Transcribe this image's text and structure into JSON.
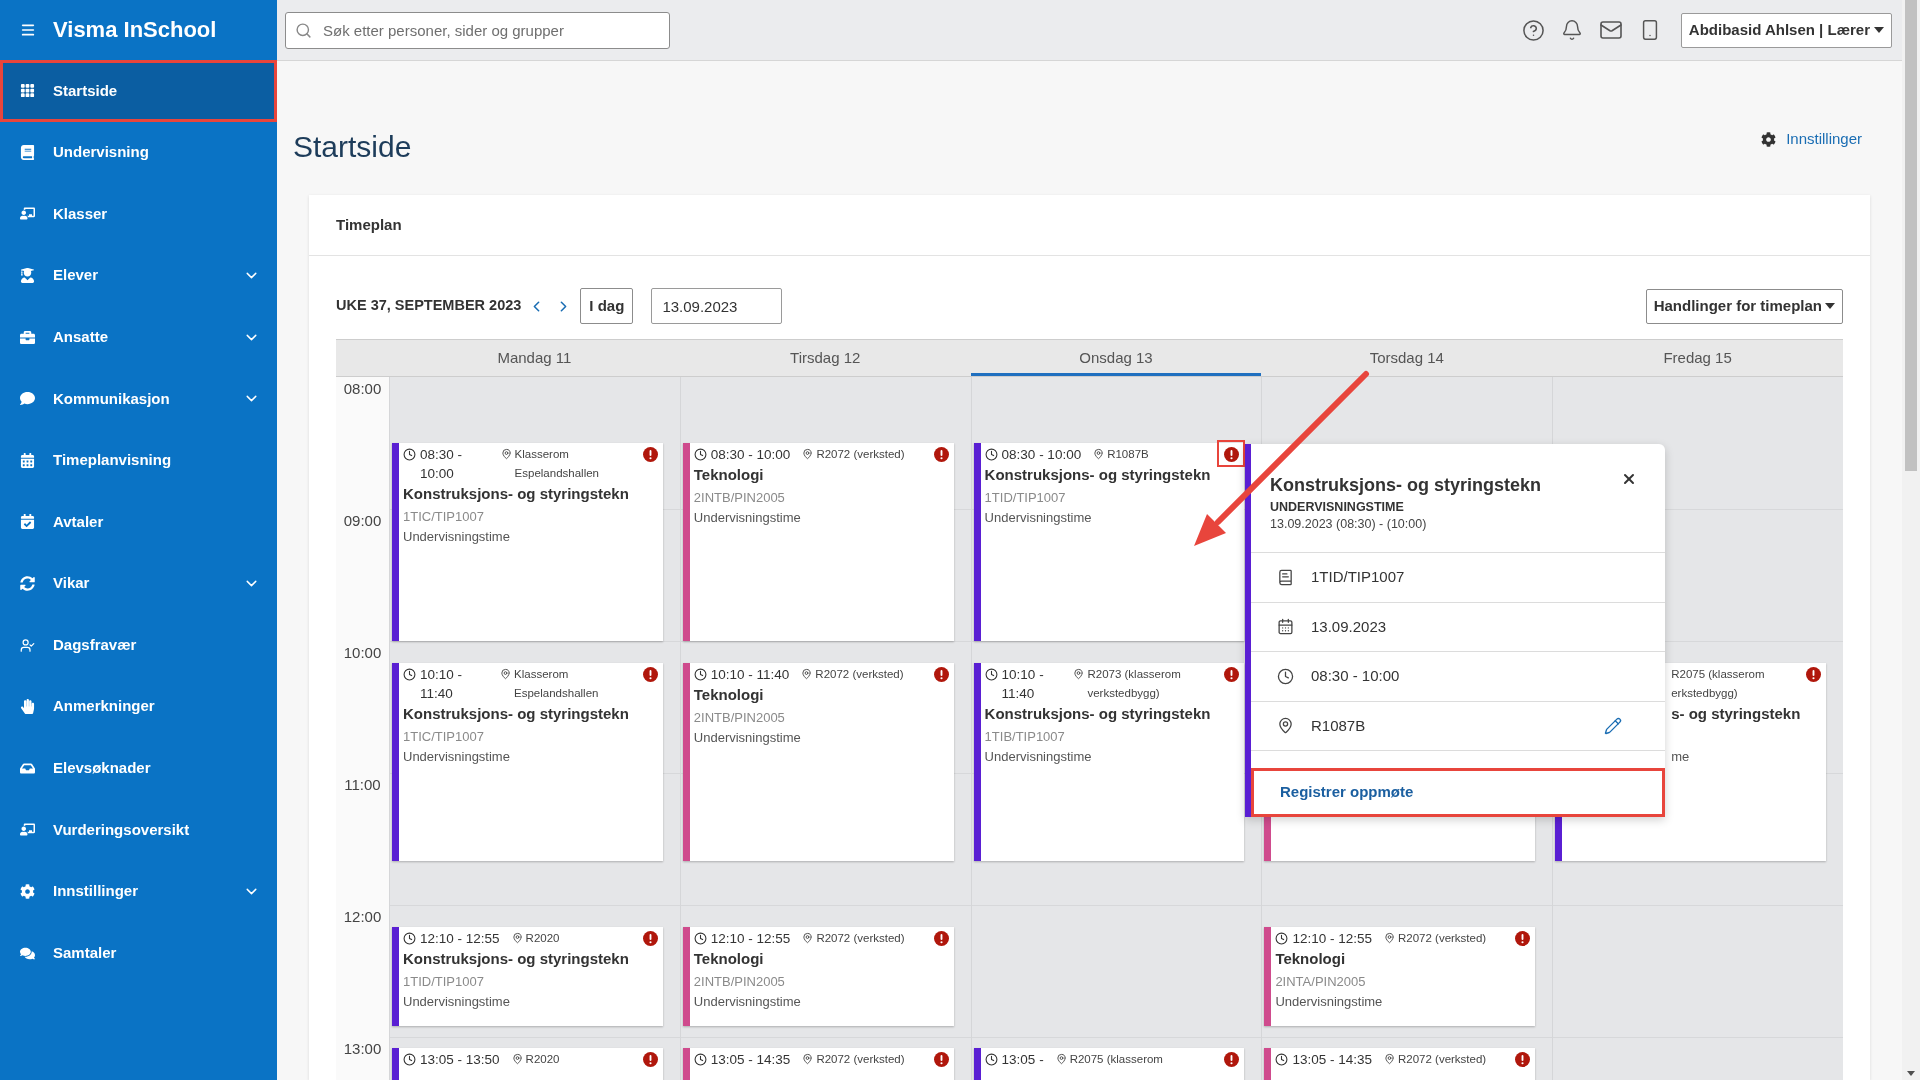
{
  "sidebar": {
    "title": "Visma InSchool",
    "items": [
      {
        "label": "Startside",
        "selected": true,
        "expandable": false,
        "highlighted": true
      },
      {
        "label": "Undervisning",
        "selected": false,
        "expandable": false,
        "highlighted": false
      },
      {
        "label": "Klasser",
        "selected": false,
        "expandable": false,
        "highlighted": false
      },
      {
        "label": "Elever",
        "selected": false,
        "expandable": true,
        "highlighted": false
      },
      {
        "label": "Ansatte",
        "selected": false,
        "expandable": true,
        "highlighted": false
      },
      {
        "label": "Kommunikasjon",
        "selected": false,
        "expandable": true,
        "highlighted": false
      },
      {
        "label": "Timeplanvisning",
        "selected": false,
        "expandable": false,
        "highlighted": false
      },
      {
        "label": "Avtaler",
        "selected": false,
        "expandable": false,
        "highlighted": false
      },
      {
        "label": "Vikar",
        "selected": false,
        "expandable": true,
        "highlighted": false
      },
      {
        "label": "Dagsfravær",
        "selected": false,
        "expandable": false,
        "highlighted": false
      },
      {
        "label": "Anmerkninger",
        "selected": false,
        "expandable": false,
        "highlighted": false
      },
      {
        "label": "Elevsøknader",
        "selected": false,
        "expandable": false,
        "highlighted": false
      },
      {
        "label": "Vurderingsoversikt",
        "selected": false,
        "expandable": false,
        "highlighted": false
      },
      {
        "label": "Innstillinger",
        "selected": false,
        "expandable": true,
        "highlighted": false
      },
      {
        "label": "Samtaler",
        "selected": false,
        "expandable": false,
        "highlighted": false
      }
    ]
  },
  "topbar": {
    "search": {
      "placeholder": "Søk etter personer, sider og grupper"
    },
    "user_menu": "Abdibasid Ahlsen | Lærer"
  },
  "page": {
    "title": "Startside",
    "settings_link": "Innstillinger"
  },
  "timeplan": {
    "title": "Timeplan",
    "week_label": "UKE 37, SEPTEMBER 2023",
    "today_button": "I dag",
    "date": "13.09.2023",
    "actions_button": "Handlinger for timeplan",
    "hours": [
      "08:00",
      "09:00",
      "10:00",
      "11:00",
      "12:00",
      "13:00"
    ],
    "days": [
      {
        "label": "Mandag 11",
        "selected": false,
        "events": [
          {
            "kind": "lesson",
            "after_free_period": false,
            "color": "#5a1fd3",
            "time": "08:30 - 10:00",
            "location": "Klasserom Espelandshallen",
            "title": "Konstruksjons- og styringstekn",
            "group": "1TIC/TIP1007",
            "type": "Undervisningstime",
            "alert": true,
            "highlighted": false
          },
          {
            "kind": "lesson",
            "after_free_period": false,
            "color": "#5a1fd3",
            "time": "10:10 - 11:40",
            "location": "Klasserom Espelandshallen",
            "title": "Konstruksjons- og styringstekn",
            "group": "1TIC/TIP1007",
            "type": "Undervisningstime",
            "alert": true,
            "highlighted": false
          },
          {
            "kind": "lesson",
            "after_free_period": false,
            "color": "#5a1fd3",
            "time": "12:10 - 12:55",
            "location": "R2020",
            "title": "Konstruksjons- og styringstekn",
            "group": "1TID/TIP1007",
            "type": "Undervisningstime",
            "alert": true,
            "highlighted": false
          },
          {
            "kind": "lesson",
            "after_free_period": false,
            "color": "#5a1fd3",
            "time": "13:05 - 13:50",
            "location": "R2020",
            "alert": true,
            "highlighted": false
          }
        ]
      },
      {
        "label": "Tirsdag 12",
        "selected": false,
        "events": [
          {
            "kind": "lesson",
            "after_free_period": false,
            "color": "#cf4b8d",
            "time": "08:30 - 10:00",
            "location": "R2072 (verksted)",
            "title": "Teknologi",
            "group": "2INTB/PIN2005",
            "type": "Undervisningstime",
            "alert": true,
            "highlighted": false
          },
          {
            "kind": "lesson",
            "after_free_period": false,
            "color": "#cf4b8d",
            "time": "10:10 - 11:40",
            "location": "R2072 (verksted)",
            "title": "Teknologi",
            "group": "2INTB/PIN2005",
            "type": "Undervisningstime",
            "alert": true,
            "highlighted": false
          },
          {
            "kind": "lesson",
            "after_free_period": false,
            "color": "#cf4b8d",
            "time": "12:10 - 12:55",
            "location": "R2072 (verksted)",
            "title": "Teknologi",
            "group": "2INTB/PIN2005",
            "type": "Undervisningstime",
            "alert": true,
            "highlighted": false
          },
          {
            "kind": "lesson",
            "after_free_period": false,
            "color": "#cf4b8d",
            "time": "13:05 - 14:35",
            "location": "R2072 (verksted)",
            "alert": true,
            "highlighted": false
          }
        ]
      },
      {
        "label": "Onsdag 13",
        "selected": true,
        "events": [
          {
            "kind": "lesson",
            "after_free_period": false,
            "color": "#5a1fd3",
            "time": "08:30 - 10:00",
            "location": "R1087B",
            "title": "Konstruksjons- og styringstekn",
            "group": "1TID/TIP1007",
            "type": "Undervisningstime",
            "alert": true,
            "highlighted": true
          },
          {
            "kind": "lesson",
            "after_free_period": false,
            "color": "#5a1fd3",
            "time": "10:10 - 11:40",
            "location": "R2073 (klasserom verkstedbygg)",
            "title": "Konstruksjons- og styringstekn",
            "group": "1TIB/TIP1007",
            "type": "Undervisningstime",
            "alert": true,
            "highlighted": false
          },
          {
            "kind": "lesson",
            "after_free_period": true,
            "color": "#5a1fd3",
            "time": "13:05 -",
            "location": "R2075 (klasserom",
            "alert": true,
            "highlighted": false
          }
        ]
      },
      {
        "label": "Torsdag 14",
        "selected": false,
        "events": [
          {
            "kind": "lesson",
            "after_free_period": true,
            "color": "#cf4b8d"
          },
          {
            "kind": "lesson",
            "after_free_period": false,
            "color": "#cf4b8d",
            "time": "12:10 - 12:55",
            "location": "R2072 (verksted)",
            "title": "Teknologi",
            "group": "2INTA/PIN2005",
            "type": "Undervisningstime",
            "alert": true,
            "highlighted": false
          },
          {
            "kind": "lesson",
            "after_free_period": false,
            "color": "#cf4b8d",
            "time": "13:05 - 14:35",
            "location": "R2072 (verksted)",
            "alert": true,
            "highlighted": false
          }
        ]
      },
      {
        "label": "Fredag 15",
        "selected": false,
        "events": [
          {
            "kind": "partly_hidden",
            "after_free_period": true,
            "color": "#5a1fd3",
            "lines": [
              {
                "kind": "location",
                "text": "R2075 (klasserom"
              },
              {
                "kind": "location",
                "text": "erkstedbygg)"
              },
              {
                "kind": "title",
                "text": "s- og styringstekn"
              },
              {
                "kind": "type",
                "text": "me"
              }
            ],
            "alert": true,
            "highlighted": false
          }
        ]
      }
    ]
  },
  "popup": {
    "title": "Konstruksjons- og styringstekn",
    "subtitle": "UNDERVISNINGSTIME",
    "when": "13.09.2023 (08:30) - (10:00)",
    "color": "#5a1fd3",
    "rows": [
      {
        "text": "1TID/TIP1007",
        "editable": false
      },
      {
        "text": "13.09.2023",
        "editable": false
      },
      {
        "text": "08:30 - 10:00",
        "editable": false
      },
      {
        "text": "R1087B",
        "editable": true
      }
    ],
    "action": {
      "label": "Registrer oppmøte",
      "highlighted": true
    }
  },
  "callout_arrow": true
}
